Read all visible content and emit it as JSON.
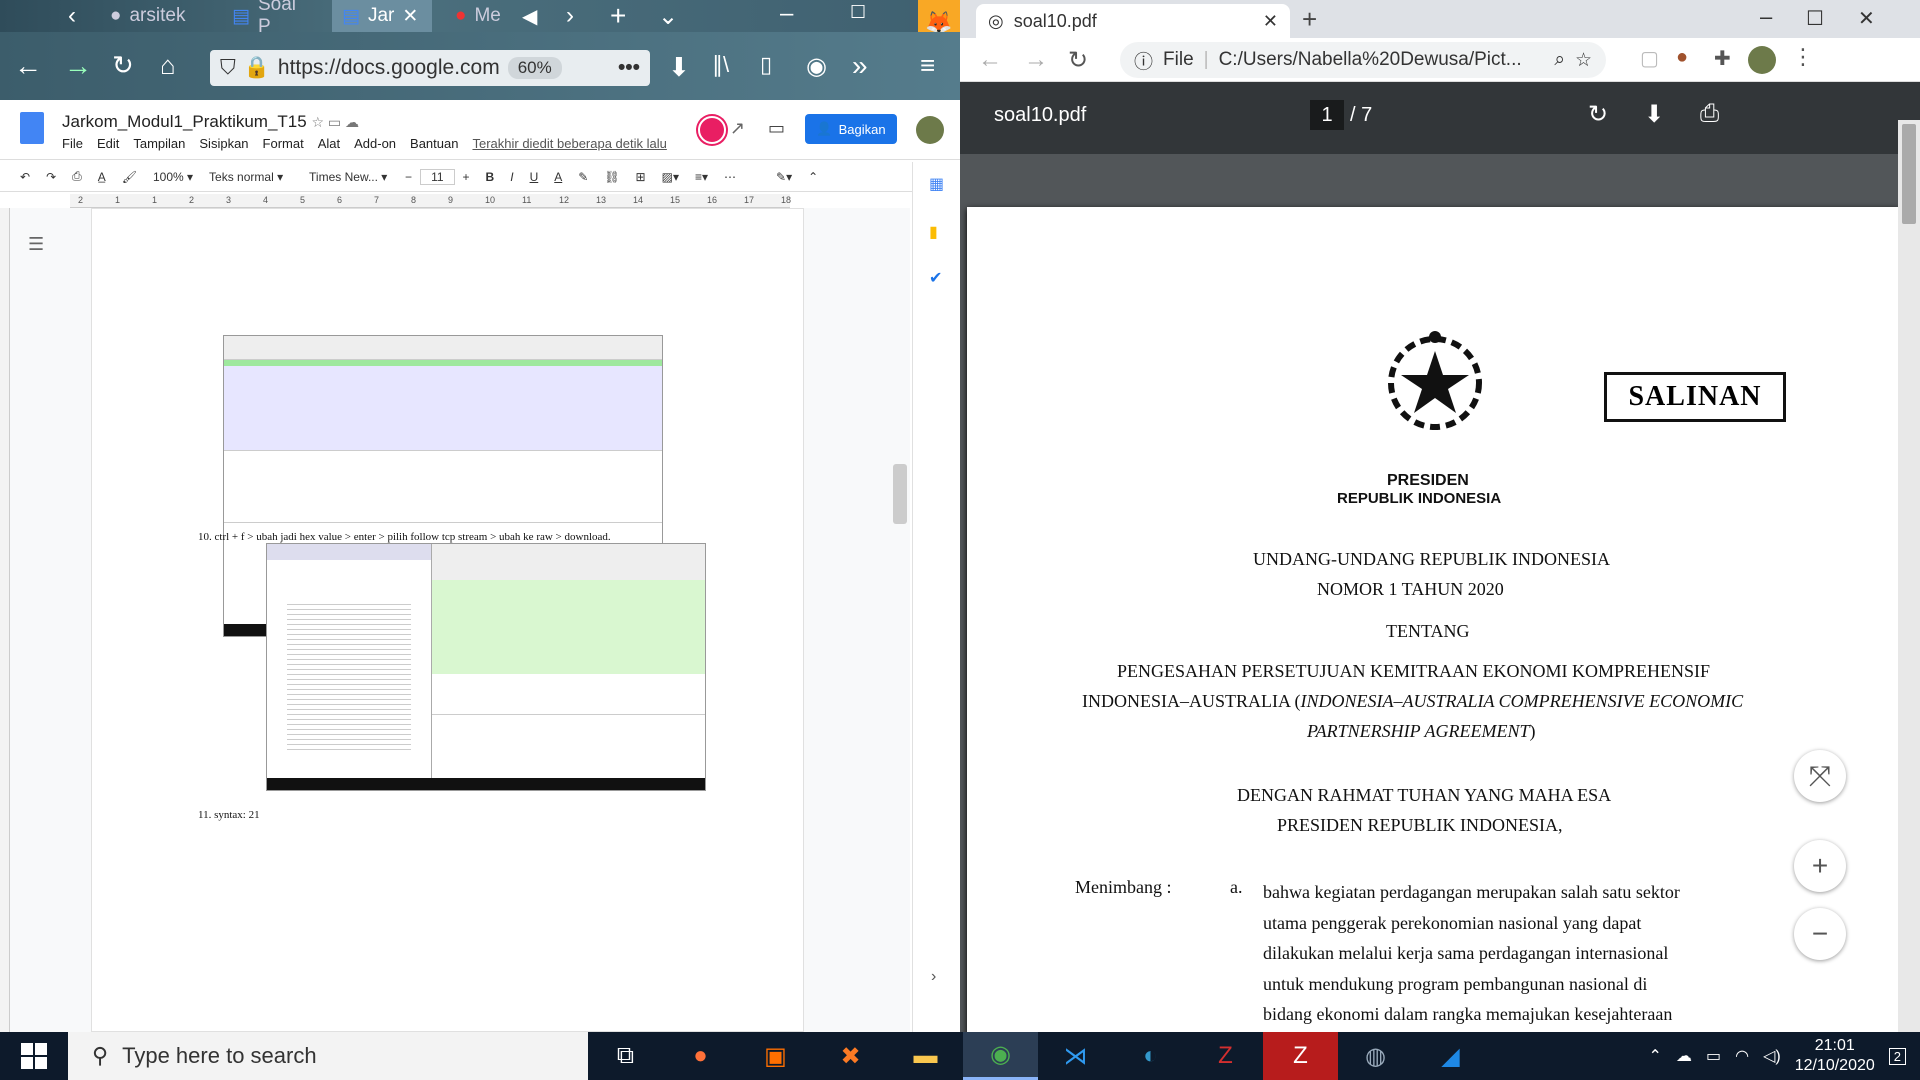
{
  "left": {
    "firefox": {
      "tabs": [
        "arsitek",
        "Soal P",
        "Jar",
        "Me"
      ],
      "url": "https://docs.google.com",
      "zoom": "60%"
    },
    "docs": {
      "title": "Jarkom_Modul1_Praktikum_T15",
      "menu": [
        "File",
        "Edit",
        "Tampilan",
        "Sisipkan",
        "Format",
        "Alat",
        "Add-on",
        "Bantuan"
      ],
      "last_edit": "Terakhir diedit beberapa detik lalu",
      "share_label": "Bagikan",
      "toolbar": {
        "zoom": "100%",
        "style": "Teks normal",
        "font": "Times New...",
        "size": "11"
      },
      "ruler_marks": [
        "2",
        "1",
        "1",
        "2",
        "3",
        "4",
        "5",
        "6",
        "7",
        "8",
        "9",
        "10",
        "11",
        "12",
        "13",
        "14",
        "15",
        "16",
        "17",
        "18"
      ],
      "step10": "10.  ctrl + f > ubah jadi hex value > enter > pilih follow tcp stream > ubah ke raw > download.",
      "step11": "11.  syntax: 21"
    }
  },
  "right": {
    "chrome": {
      "tab_title": "soal10.pdf",
      "url_prefix": "File",
      "url": "C:/Users/Nabella%20Dewusa/Pict..."
    },
    "pdf": {
      "filename": "soal10.pdf",
      "page_current": "1",
      "page_total": "/  7",
      "salinan": "SALINAN",
      "presiden": "PRESIDEN",
      "republik": "REPUBLIK  INDONESIA",
      "uu": "UNDANG-UNDANG REPUBLIK INDONESIA",
      "nomor": "NOMOR  1  TAHUN  2020",
      "tentang": "TENTANG",
      "judul1": "PENGESAHAN PERSETUJUAN KEMITRAAN EKONOMI KOMPREHENSIF",
      "judul2_pre": "INDONESIA–AUSTRALIA (",
      "judul2_it": "INDONESIA–AUSTRALIA COMPREHENSIVE ECONOMIC",
      "judul3_it": "PARTNERSHIP AGREEMENT",
      "judul3_post": ")",
      "rahmat": "DENGAN RAHMAT TUHAN YANG MAHA ESA",
      "presri": "PRESIDEN REPUBLIK INDONESIA,",
      "menimbang": "Menimbang  :",
      "a": "a.",
      "lines": [
        "bahwa kegiatan perdagangan merupakan salah satu sektor",
        "utama   penggerak   perekonomian   nasional   yang   dapat",
        "dilakukan melalui kerja sama perdagangan internasional",
        "untuk   mendukung   program   pembangunan   nasional   di",
        "bidang  ekonomi  dalam  rangka  memajukan  kesejahteraan"
      ]
    }
  },
  "taskbar": {
    "search_placeholder": "Type here to search",
    "time": "21:01",
    "date": "12/10/2020",
    "notif_count": "2"
  }
}
